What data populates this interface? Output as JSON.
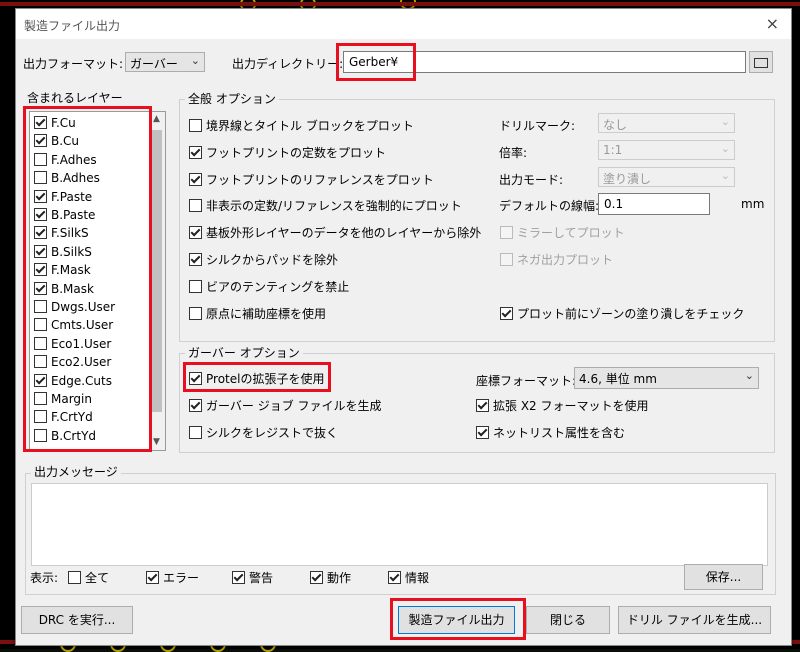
{
  "window": {
    "title": "製造ファイル出力",
    "close_glyph": "×"
  },
  "format": {
    "label": "出力フォーマット:",
    "value": "ガーバー"
  },
  "directory": {
    "label": "出力ディレクトリー:",
    "value": "Gerber¥"
  },
  "layers": {
    "title": "含まれるレイヤー",
    "items": [
      {
        "name": "F.Cu",
        "checked": true
      },
      {
        "name": "B.Cu",
        "checked": true
      },
      {
        "name": "F.Adhes",
        "checked": false
      },
      {
        "name": "B.Adhes",
        "checked": false
      },
      {
        "name": "F.Paste",
        "checked": true
      },
      {
        "name": "B.Paste",
        "checked": true
      },
      {
        "name": "F.SilkS",
        "checked": true
      },
      {
        "name": "B.SilkS",
        "checked": true
      },
      {
        "name": "F.Mask",
        "checked": true
      },
      {
        "name": "B.Mask",
        "checked": true
      },
      {
        "name": "Dwgs.User",
        "checked": false
      },
      {
        "name": "Cmts.User",
        "checked": false
      },
      {
        "name": "Eco1.User",
        "checked": false
      },
      {
        "name": "Eco2.User",
        "checked": false
      },
      {
        "name": "Edge.Cuts",
        "checked": true
      },
      {
        "name": "Margin",
        "checked": false
      },
      {
        "name": "F.CrtYd",
        "checked": false
      },
      {
        "name": "B.CrtYd",
        "checked": false
      }
    ]
  },
  "general": {
    "title": "全般 オプション",
    "options": [
      {
        "label": "境界線とタイトル ブロックをプロット",
        "checked": false
      },
      {
        "label": "フットプリントの定数をプロット",
        "checked": true
      },
      {
        "label": "フットプリントのリファレンスをプロット",
        "checked": true
      },
      {
        "label": "非表示の定数/リファレンスを強制的にプロット",
        "checked": false
      },
      {
        "label": "基板外形レイヤーのデータを他のレイヤーから除外",
        "checked": true
      },
      {
        "label": "シルクからパッドを除外",
        "checked": true
      },
      {
        "label": "ビアのテンティングを禁止",
        "checked": false
      },
      {
        "label": "原点に補助座標を使用",
        "checked": false
      }
    ],
    "drill_mark": {
      "label": "ドリルマーク:",
      "value": "なし"
    },
    "scale": {
      "label": "倍率:",
      "value": "1:1"
    },
    "plot_mode": {
      "label": "出力モード:",
      "value": "塗り潰し"
    },
    "default_width": {
      "label": "デフォルトの線幅:",
      "value": "0.1",
      "unit": "mm"
    },
    "mirror": {
      "label": "ミラーしてプロット",
      "checked": false
    },
    "negative": {
      "label": "ネガ出力プロット",
      "checked": false
    },
    "zone_check": {
      "label": "プロット前にゾーンの塗り潰しをチェック",
      "checked": true
    }
  },
  "gerber": {
    "title": "ガーバー オプション",
    "protel": {
      "label": "Protelの拡張子を使用",
      "checked": true
    },
    "job_file": {
      "label": "ガーバー ジョブ ファイルを生成",
      "checked": true
    },
    "subtract_mask": {
      "label": "シルクをレジストで抜く",
      "checked": false
    },
    "coord_format": {
      "label": "座標フォーマット:",
      "value": "4.6, 単位 mm"
    },
    "x2": {
      "label": "拡張 X2 フォーマットを使用",
      "checked": true
    },
    "netlist": {
      "label": "ネットリスト属性を含む",
      "checked": true
    }
  },
  "messages": {
    "title": "出力メッセージ",
    "show_label": "表示:",
    "filters": [
      {
        "label": "全て",
        "checked": false
      },
      {
        "label": "エラー",
        "checked": true
      },
      {
        "label": "警告",
        "checked": true
      },
      {
        "label": "動作",
        "checked": true
      },
      {
        "label": "情報",
        "checked": true
      }
    ],
    "save_label": "保存..."
  },
  "buttons": {
    "drc": "DRC を実行...",
    "plot": "製造ファイル出力",
    "close": "閉じる",
    "drill": "ドリル ファイルを生成..."
  },
  "colors": {
    "highlight": "#e8101e",
    "pcb_background": "#000000",
    "pad": "#b8a000"
  }
}
